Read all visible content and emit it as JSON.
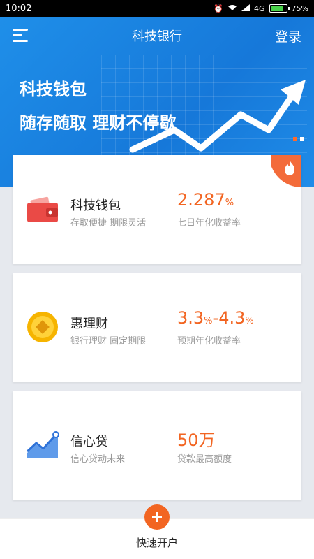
{
  "status_bar": {
    "time": "10:02",
    "network": "4G",
    "battery": "75%"
  },
  "header": {
    "title": "科技银行",
    "login_label": "登录"
  },
  "banner": {
    "title": "科技钱包",
    "subtitle": "随存随取 理财不停歇",
    "page_count": 2,
    "active_page": 1
  },
  "products": [
    {
      "name": "科技钱包",
      "description": "存取便捷 期限灵活",
      "rate_value": "2.287",
      "rate_unit": "%",
      "rate_label": "七日年化收益率",
      "icon": "wallet-icon",
      "hot": true
    },
    {
      "name": "惠理财",
      "description": "银行理财 固定期限",
      "rate_min": "3.3",
      "rate_max": "4.3",
      "rate_unit": "%",
      "rate_sep": "-",
      "rate_label": "预期年化收益率",
      "icon": "coin-icon"
    },
    {
      "name": "信心贷",
      "description": "信心贷动未来",
      "rate_value": "50万",
      "rate_label": "贷款最高额度",
      "icon": "chart-icon"
    }
  ],
  "bottom": {
    "open_account_label": "快速开户"
  },
  "colors": {
    "primary": "#1a80e0",
    "accent": "#f26522",
    "background": "#e6e9ee"
  }
}
